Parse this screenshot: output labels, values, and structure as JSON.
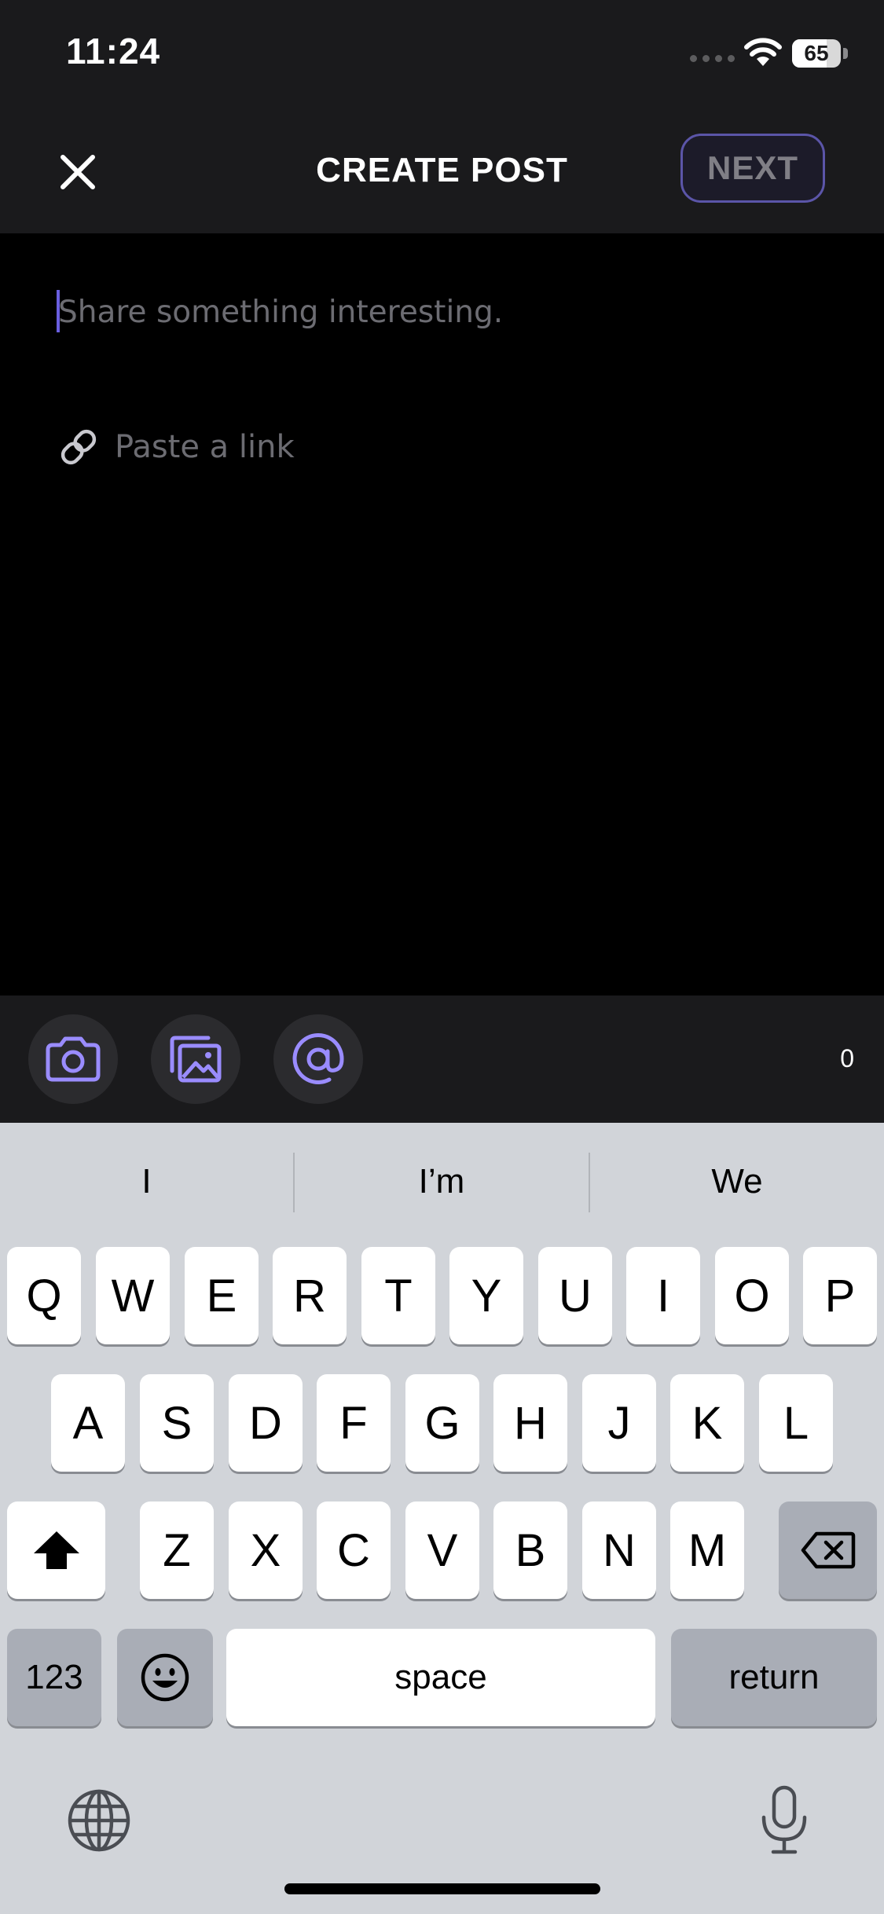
{
  "status_bar": {
    "time": "11:24",
    "battery": "65"
  },
  "header": {
    "title": "CREATE POST",
    "next_label": "NEXT"
  },
  "compose": {
    "placeholder": "Share something interesting.",
    "link_placeholder": "Paste a link"
  },
  "toolbar": {
    "icons": [
      "camera-icon",
      "gallery-icon",
      "mention-icon"
    ],
    "char_count": "0",
    "accent": "#9a8cff"
  },
  "keyboard": {
    "suggestions": [
      "I",
      "I’m",
      "We"
    ],
    "row1": [
      "Q",
      "W",
      "E",
      "R",
      "T",
      "Y",
      "U",
      "I",
      "O",
      "P"
    ],
    "row2": [
      "A",
      "S",
      "D",
      "F",
      "G",
      "H",
      "J",
      "K",
      "L"
    ],
    "row3": [
      "Z",
      "X",
      "C",
      "V",
      "B",
      "N",
      "M"
    ],
    "numbers_label": "123",
    "space_label": "space",
    "return_label": "return"
  }
}
